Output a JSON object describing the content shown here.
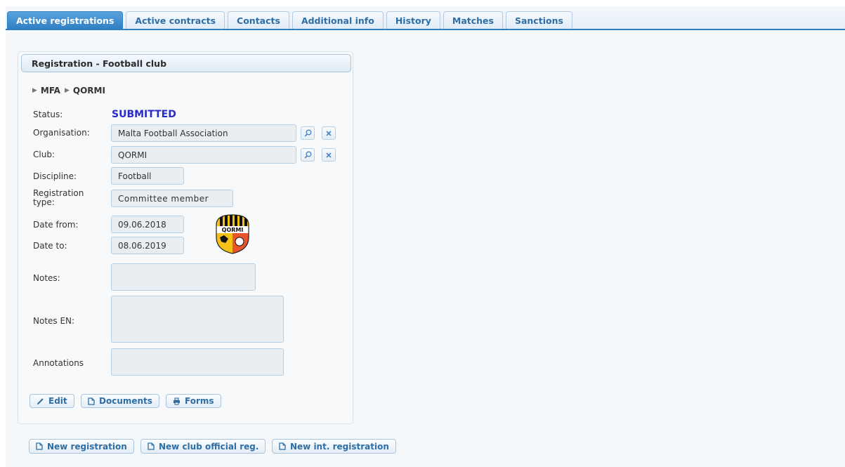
{
  "tabs": [
    {
      "label": "Active registrations",
      "active": true
    },
    {
      "label": "Active contracts"
    },
    {
      "label": "Contacts"
    },
    {
      "label": "Additional info"
    },
    {
      "label": "History"
    },
    {
      "label": "Matches"
    },
    {
      "label": "Sanctions"
    }
  ],
  "panel": {
    "title": "Registration - Football club",
    "breadcrumb": [
      "MFA",
      "QORMI"
    ]
  },
  "form": {
    "status_label": "Status:",
    "status_value": "SUBMITTED",
    "status_color": "#2a2ac8",
    "organisation_label": "Organisation:",
    "organisation_value": "Malta Football Association",
    "club_label": "Club:",
    "club_value": "QORMI",
    "discipline_label": "Discipline:",
    "discipline_value": "Football",
    "registration_type_label": "Registration type:",
    "registration_type_value": "Committee member",
    "date_from_label": "Date from:",
    "date_from_value": "09.06.2018",
    "date_to_label": "Date to:",
    "date_to_value": "08.06.2019",
    "notes_label": "Notes:",
    "notes_value": "",
    "notes_en_label": "Notes EN:",
    "notes_en_value": "",
    "annotations_label": "Annotations",
    "annotations_value": ""
  },
  "club_logo": {
    "text": "QORMI",
    "icon": "club-crest-logo"
  },
  "panel_buttons": {
    "edit": "Edit",
    "documents": "Documents",
    "forms": "Forms"
  },
  "bottom_buttons": {
    "new_registration": "New registration",
    "new_club_official": "New club official reg.",
    "new_int_registration": "New int. registration"
  },
  "colors": {
    "accent": "#2f7fc3",
    "link": "#2e6ea5"
  }
}
